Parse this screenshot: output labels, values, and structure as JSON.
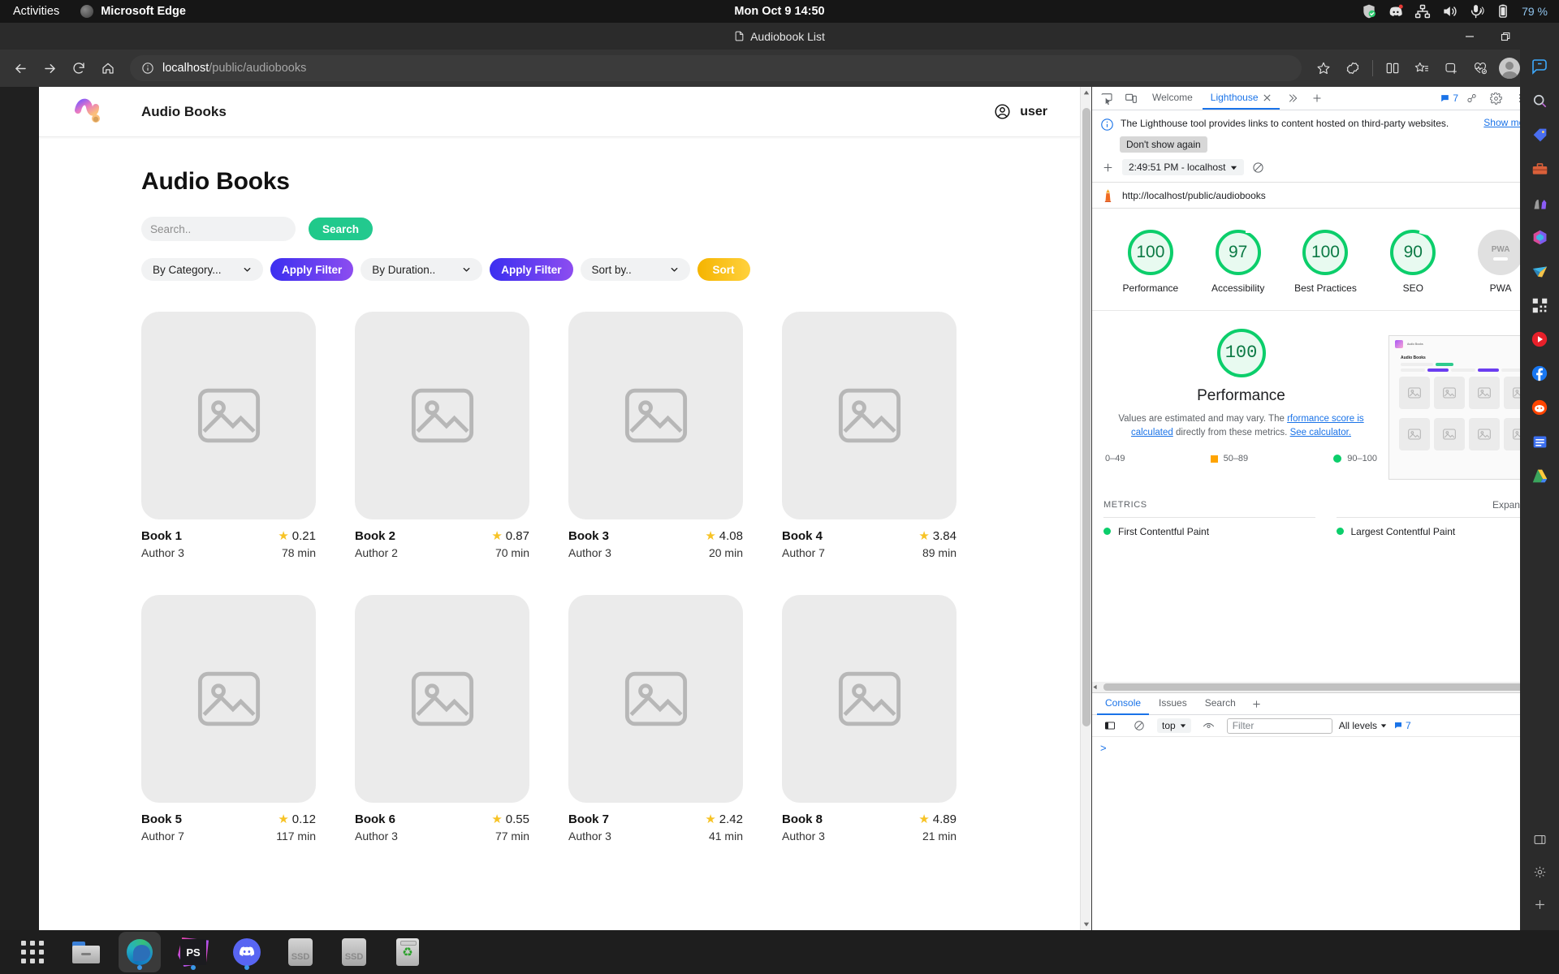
{
  "desktop": {
    "activities_label": "Activities",
    "focused_app": "Microsoft Edge",
    "clock": "Mon Oct 9  14:50",
    "battery_percent": "79 %",
    "tray_icons": [
      "shield-check-icon",
      "discord-icon",
      "network-icon",
      "volume-icon",
      "microphone-icon",
      "battery-icon"
    ]
  },
  "browser": {
    "window_title": "Audiobook List",
    "window_controls": [
      "minimize",
      "restore",
      "close"
    ],
    "nav": {
      "back": "back-arrow-icon",
      "forward": "forward-arrow-icon",
      "reload": "reload-icon",
      "home": "home-icon"
    },
    "omnibox": {
      "info_icon": "info-circle-icon",
      "host": "localhost",
      "path": "/public/audiobooks",
      "full_url": "localhost/public/audiobooks"
    },
    "toolbar_icons": [
      "favorite-star-icon",
      "collections-icon",
      "split-screen-icon",
      "favorites-list-icon",
      "add-collection-icon",
      "performance-icon",
      "profile-avatar",
      "settings-more-icon"
    ],
    "sidebar_icons": [
      "copilot-icon",
      "search-icon",
      "shopping-tag-icon",
      "tools-icon",
      "games-icon",
      "office-icon",
      "outlook-icon",
      "qr-icon",
      "youtube-icon",
      "facebook-icon",
      "reddit-icon",
      "notes-icon",
      "drive-icon",
      "add-sidebar-icon"
    ]
  },
  "page": {
    "header": {
      "logo": "squiggle-logo",
      "brand": "Audio Books",
      "user_icon": "user-circle-icon",
      "user_label": "user"
    },
    "title": "Audio Books",
    "search": {
      "placeholder": "Search..",
      "value": "",
      "icon": "search-icon",
      "button_label": "Search"
    },
    "filters": {
      "category_select": "By Category...",
      "category_button": "Apply Filter",
      "duration_select": "By Duration..",
      "duration_button": "Apply Filter",
      "sort_select": "Sort by..",
      "sort_button": "Sort"
    },
    "books": [
      {
        "title": "Book 1",
        "author": "Author 3",
        "rating": "0.21",
        "duration": "78 min"
      },
      {
        "title": "Book 2",
        "author": "Author 2",
        "rating": "0.87",
        "duration": "70 min"
      },
      {
        "title": "Book 3",
        "author": "Author 3",
        "rating": "4.08",
        "duration": "20 min"
      },
      {
        "title": "Book 4",
        "author": "Author 7",
        "rating": "3.84",
        "duration": "89 min"
      },
      {
        "title": "Book 5",
        "author": "Author 7",
        "rating": "0.12",
        "duration": "117 min"
      },
      {
        "title": "Book 6",
        "author": "Author 3",
        "rating": "0.55",
        "duration": "77 min"
      },
      {
        "title": "Book 7",
        "author": "Author 3",
        "rating": "2.42",
        "duration": "41 min"
      },
      {
        "title": "Book 8",
        "author": "Author 3",
        "rating": "4.89",
        "duration": "21 min"
      }
    ]
  },
  "devtools": {
    "tabs": [
      {
        "label": "Welcome",
        "active": false
      },
      {
        "label": "Lighthouse",
        "active": true
      }
    ],
    "more_tabs_icon": "chevron-double-right-icon",
    "add_tab_icon": "plus-icon",
    "issue_count": "7",
    "toolbar_icons": [
      "inspect-icon",
      "device-toolbar-icon",
      "settings-gear-icon",
      "more-vertical-icon",
      "close-icon"
    ],
    "banner": {
      "text": "The Lighthouse tool provides links to content hosted on third-party websites.",
      "show_more": "Show more",
      "dismiss_label": "Don't show again",
      "close_icon": "close-icon"
    },
    "lighthouse": {
      "new_run_icon": "plus-icon",
      "run_selector": "2:49:51 PM - localhost",
      "clear_icon": "no-entry-icon",
      "audited_url": "http://localhost/public/audiobooks",
      "url_menu_icon": "more-vertical-icon",
      "gauges": [
        {
          "score": "100",
          "label": "Performance"
        },
        {
          "score": "97",
          "label": "Accessibility"
        },
        {
          "score": "100",
          "label": "Best Practices"
        },
        {
          "score": "90",
          "label": "SEO"
        },
        {
          "score": "PWA",
          "label": "PWA"
        }
      ],
      "performance": {
        "score": "100",
        "heading": "Performance",
        "description_1": "Values are estimated and may vary. The",
        "description_link_1": "rformance score is calculated",
        "description_2": "directly from these metrics.",
        "description_link_2": "See calculator.",
        "legend": [
          {
            "range": "0–49",
            "marker": "triangle"
          },
          {
            "range": "50–89",
            "marker": "square"
          },
          {
            "range": "90–100",
            "marker": "circle"
          }
        ]
      },
      "metrics": {
        "section_label": "METRICS",
        "expand_label": "Expand view",
        "items": [
          {
            "name": "First Contentful Paint",
            "status": "pass"
          },
          {
            "name": "Largest Contentful Paint",
            "status": "pass"
          }
        ]
      }
    },
    "drawer": {
      "tabs": [
        {
          "label": "Console",
          "active": true
        },
        {
          "label": "Issues",
          "active": false
        },
        {
          "label": "Search",
          "active": false
        }
      ],
      "add_tab_icon": "plus-icon",
      "close_icon": "close-icon",
      "console": {
        "sidebar_icon": "console-sidebar-icon",
        "clear_icon": "no-entry-icon",
        "context": "top",
        "eye_icon": "live-expression-icon",
        "filter_placeholder": "Filter",
        "filter_value": "",
        "levels": "All levels",
        "issue_count": "7",
        "settings_icon": "settings-gear-icon",
        "prompt": ">"
      }
    }
  },
  "taskbar": {
    "items": [
      {
        "name": "app-grid",
        "label": "Show Applications",
        "running": false
      },
      {
        "name": "files",
        "label": "Files",
        "running": false
      },
      {
        "name": "microsoft-edge",
        "label": "Microsoft Edge",
        "running": true
      },
      {
        "name": "phpstorm",
        "label": "PS",
        "running": true
      },
      {
        "name": "discord",
        "label": "Discord",
        "running": true
      },
      {
        "name": "ssd-drive-1",
        "label": "SSD",
        "running": false
      },
      {
        "name": "ssd-drive-2",
        "label": "SSD",
        "running": false
      },
      {
        "name": "trash",
        "label": "Trash",
        "running": false
      }
    ]
  }
}
